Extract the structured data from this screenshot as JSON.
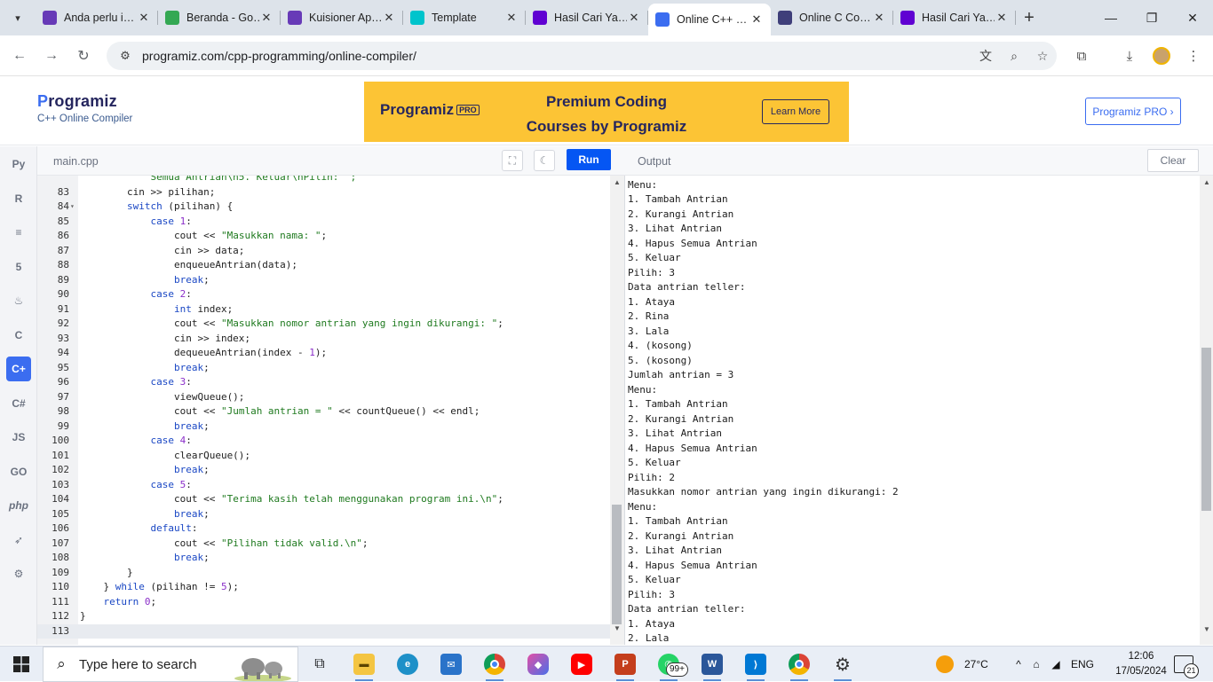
{
  "browser": {
    "tabs": [
      {
        "title": "Anda perlu i…",
        "favicon": "forms-icon",
        "color": "#673ab7"
      },
      {
        "title": "Beranda - Go…",
        "favicon": "google-drive-icon",
        "color": "#34a853"
      },
      {
        "title": "Kuisioner Ap…",
        "favicon": "forms-icon",
        "color": "#673ab7"
      },
      {
        "title": "Template",
        "favicon": "canva-icon",
        "color": "#00c4cc"
      },
      {
        "title": "Hasil Cari Ya…",
        "favicon": "yahoo-icon",
        "color": "#6001d2"
      },
      {
        "title": "Online C++ …",
        "favicon": "programiz-icon",
        "color": "#3b6df0",
        "active": true
      },
      {
        "title": "Online C Co…",
        "favicon": "onecompiler-icon",
        "color": "#3f3f7a"
      },
      {
        "title": "Hasil Cari Ya…",
        "favicon": "yahoo-icon",
        "color": "#6001d2"
      }
    ],
    "url": "programiz.com/cpp-programming/online-compiler/"
  },
  "site": {
    "logo": "Programiz",
    "subtitle": "C++ Online Compiler",
    "banner": {
      "logo": "Programiz",
      "logo_badge": "PRO",
      "headline_1": "Premium Coding",
      "headline_2": "Courses by Programiz",
      "button": "Learn More"
    },
    "pro_button": "Programiz PRO ›"
  },
  "editor": {
    "file_tab": "main.cpp",
    "run_label": "Run",
    "partial_top_line": "Semua Antrian\\n5. Keluar\\nPilih: \";",
    "lines": [
      {
        "n": "83",
        "code": "        cin >> pilihan;"
      },
      {
        "n": "84",
        "code": "        switch (pilihan) {",
        "fold": true
      },
      {
        "n": "85",
        "code": "            case 1:"
      },
      {
        "n": "86",
        "code": "                cout << \"Masukkan nama: \";"
      },
      {
        "n": "87",
        "code": "                cin >> data;"
      },
      {
        "n": "88",
        "code": "                enqueueAntrian(data);"
      },
      {
        "n": "89",
        "code": "                break;"
      },
      {
        "n": "90",
        "code": "            case 2:"
      },
      {
        "n": "91",
        "code": "                int index;"
      },
      {
        "n": "92",
        "code": "                cout << \"Masukkan nomor antrian yang ingin dikurangi: \";"
      },
      {
        "n": "93",
        "code": "                cin >> index;"
      },
      {
        "n": "94",
        "code": "                dequeueAntrian(index - 1);"
      },
      {
        "n": "95",
        "code": "                break;"
      },
      {
        "n": "96",
        "code": "            case 3:"
      },
      {
        "n": "97",
        "code": "                viewQueue();"
      },
      {
        "n": "98",
        "code": "                cout << \"Jumlah antrian = \" << countQueue() << endl;"
      },
      {
        "n": "99",
        "code": "                break;"
      },
      {
        "n": "100",
        "code": "            case 4:"
      },
      {
        "n": "101",
        "code": "                clearQueue();"
      },
      {
        "n": "102",
        "code": "                break;"
      },
      {
        "n": "103",
        "code": "            case 5:"
      },
      {
        "n": "104",
        "code": "                cout << \"Terima kasih telah menggunakan program ini.\\n\";"
      },
      {
        "n": "105",
        "code": "                break;"
      },
      {
        "n": "106",
        "code": "            default:"
      },
      {
        "n": "107",
        "code": "                cout << \"Pilihan tidak valid.\\n\";"
      },
      {
        "n": "108",
        "code": "                break;"
      },
      {
        "n": "109",
        "code": "        }"
      },
      {
        "n": "110",
        "code": "    } while (pilihan != 5);"
      },
      {
        "n": "111",
        "code": "    return 0;"
      },
      {
        "n": "112",
        "code": "}"
      },
      {
        "n": "113",
        "code": "",
        "current": true
      }
    ]
  },
  "output": {
    "title": "Output",
    "clear_label": "Clear",
    "lines": [
      "Menu:",
      "1. Tambah Antrian",
      "2. Kurangi Antrian",
      "3. Lihat Antrian",
      "4. Hapus Semua Antrian",
      "5. Keluar",
      "Pilih: 3",
      "Data antrian teller:",
      "1. Ataya",
      "2. Rina",
      "3. Lala",
      "4. (kosong)",
      "5. (kosong)",
      "Jumlah antrian = 3",
      "Menu:",
      "1. Tambah Antrian",
      "2. Kurangi Antrian",
      "3. Lihat Antrian",
      "4. Hapus Semua Antrian",
      "5. Keluar",
      "Pilih: 2",
      "Masukkan nomor antrian yang ingin dikurangi: 2",
      "Menu:",
      "1. Tambah Antrian",
      "2. Kurangi Antrian",
      "3. Lihat Antrian",
      "4. Hapus Semua Antrian",
      "5. Keluar",
      "Pilih: 3",
      "Data antrian teller:",
      "1. Ataya",
      "2. Lala"
    ]
  },
  "languages": [
    "python-icon",
    "r-icon",
    "sql-icon",
    "html-icon",
    "java-icon",
    "c-icon",
    "cpp-icon",
    "csharp-icon",
    "js-icon",
    "go-icon",
    "php-icon",
    "swift-icon",
    "rust-icon"
  ],
  "taskbar": {
    "search_placeholder": "Type here to search",
    "whatsapp_badge": "99+",
    "weather": "27°C",
    "language": "ENG",
    "time": "12:06",
    "date": "17/05/2024",
    "notifications": "21"
  }
}
